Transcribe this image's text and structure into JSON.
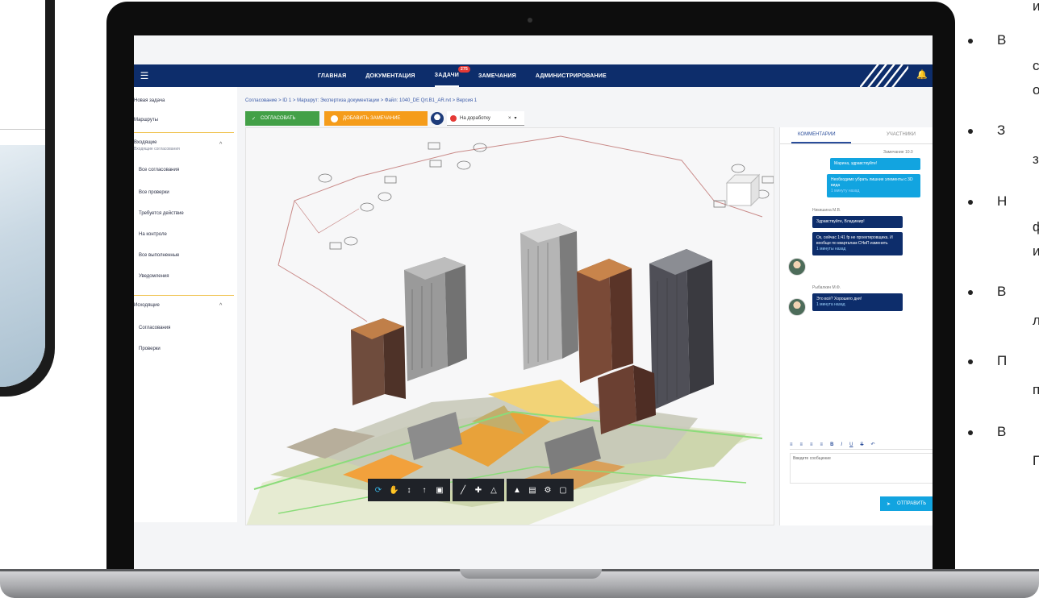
{
  "app": {
    "nav": [
      {
        "label": "ГЛАВНАЯ"
      },
      {
        "label": "ДОКУМЕНТАЦИЯ"
      },
      {
        "label": "ЗАДАЧИ",
        "badge": "275"
      },
      {
        "label": "ЗАМЕЧАНИЯ"
      },
      {
        "label": "АДМИНИСТРИРОВАНИЕ"
      }
    ],
    "sidebar": {
      "items": [
        "Новая задача",
        "Маршруты"
      ],
      "section1_title": "Входящие",
      "section1_sub": "Входящие согласования",
      "section1_items": [
        "Все согласования",
        "Все проверки",
        "Требуется действие",
        "На контроле",
        "Все выполненные",
        "Уведомления"
      ],
      "section2_title": "Исходящие",
      "section2_items": [
        "Согласования",
        "Проверки"
      ]
    },
    "breadcrumb": "Согласование  >  ID 1  >  Маршрут: Экспертиза документации  >  Файл: 1040_DE Qrt.B1_AR.rvt  >  Версия 1",
    "actions": {
      "approve": "СОГЛАСОВАТЬ",
      "remarks": "ДОБАВИТЬ ЗАМЕЧАНИЕ",
      "status": "На доработку"
    },
    "right_panel": {
      "tab_comments": "КОММЕНТАРИИ",
      "tab_participants": "УЧАСТНИКИ",
      "messages": [
        {
          "author": "Замечание 10.0",
          "text": "Марина, здравствуйте!"
        },
        {
          "author": "",
          "text": "Необходимо убрать лишние элементы с 3D вида",
          "time": "1 минуту назад"
        },
        {
          "author": "Никишина М.В.",
          "text": "Здравствуйте, Владимир!"
        },
        {
          "author": "",
          "text": "Ок, сейчас 1:41 fp не проектировщика. И вообще по кварталам СНиП изменить",
          "time": "1 минуты назад"
        },
        {
          "author": "Рыбалкин М.Ф.",
          "text": "Это всё? Хорошего дня!",
          "time": "1 минута назад"
        }
      ],
      "editor_placeholder": "Введите сообщение",
      "send": "ОТПРАВИТЬ"
    }
  },
  "bullet_list": [
    {
      "line1": "",
      "line2": "и"
    },
    {
      "line1": "В",
      "line2": "с",
      "line3": "о"
    },
    {
      "line1": "З",
      "line2": "з"
    },
    {
      "line1": "Н",
      "line2": "ф",
      "line3": "и"
    },
    {
      "line1": "В",
      "line2": "л"
    },
    {
      "line1": "П",
      "line2": "п"
    },
    {
      "line1": "В",
      "line2": "П"
    }
  ],
  "colors": {
    "navbar": "#0d2d6b",
    "approve": "#43a047",
    "remarks": "#f59c1a",
    "accent": "#12a4e0"
  }
}
